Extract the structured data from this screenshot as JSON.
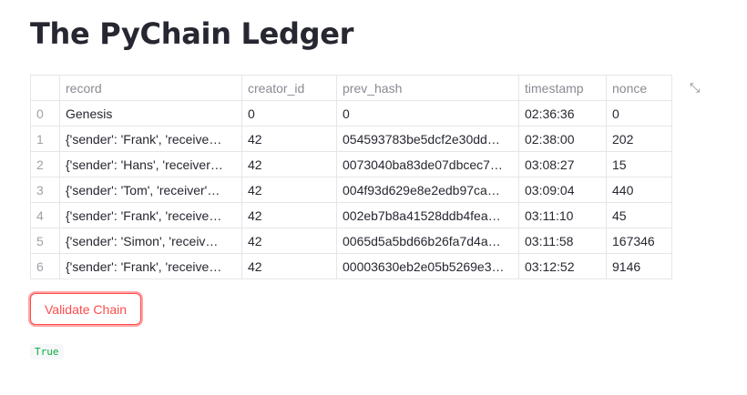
{
  "title": "The PyChain Ledger",
  "table": {
    "columns": [
      "",
      "record",
      "creator_id",
      "prev_hash",
      "timestamp",
      "nonce"
    ],
    "rows": [
      [
        "0",
        "Genesis",
        "0",
        "0",
        "02:36:36",
        "0"
      ],
      [
        "1",
        "{'sender': 'Frank', 'receive…",
        "42",
        "054593783be5dcf2e30dd…",
        "02:38:00",
        "202"
      ],
      [
        "2",
        "{'sender': 'Hans', 'receiver…",
        "42",
        "0073040ba83de07dbcec7…",
        "03:08:27",
        "15"
      ],
      [
        "3",
        "{'sender': 'Tom', 'receiver'…",
        "42",
        "004f93d629e8e2edb97ca…",
        "03:09:04",
        "440"
      ],
      [
        "4",
        "{'sender': 'Frank', 'receive…",
        "42",
        "002eb7b8a41528ddb4fea…",
        "03:11:10",
        "45"
      ],
      [
        "5",
        "{'sender': 'Simon', 'receiv…",
        "42",
        "0065d5a5bd66b26fa7d4a…",
        "03:11:58",
        "167346"
      ],
      [
        "6",
        "{'sender': 'Frank', 'receive…",
        "42",
        "00003630eb2e05b5269e3…",
        "03:12:52",
        "9146"
      ]
    ]
  },
  "expand_icon": "⤡",
  "button_label": "Validate Chain",
  "result": "True"
}
